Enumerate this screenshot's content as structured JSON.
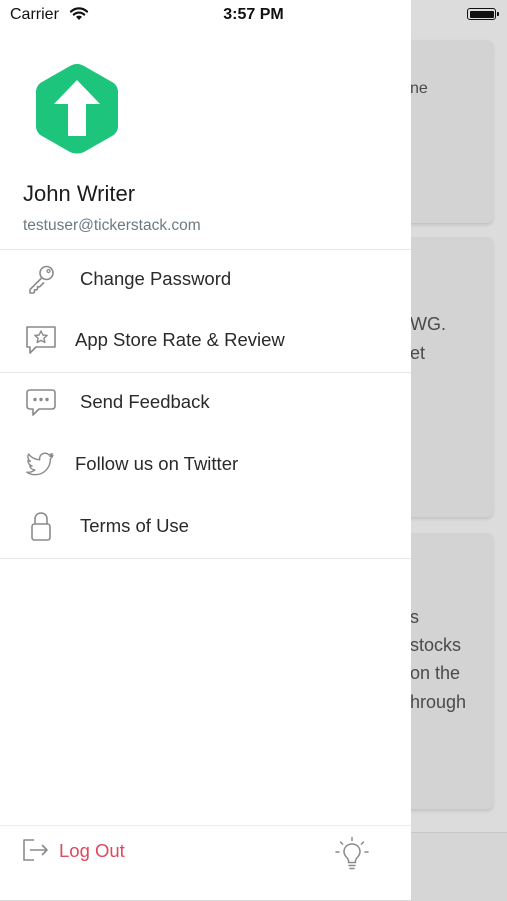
{
  "status_bar": {
    "carrier": "Carrier",
    "time": "3:57 PM"
  },
  "drawer": {
    "user": {
      "name": "John Writer",
      "email": "testuser@tickerstack.com"
    },
    "menu": [
      {
        "label": "Change Password",
        "icon": "key-icon"
      },
      {
        "label": "App Store Rate & Review",
        "icon": "star-speech-bubble-icon"
      },
      {
        "label": "Send Feedback",
        "icon": "chat-bubble-icon"
      },
      {
        "label": "Follow us on Twitter",
        "icon": "twitter-icon"
      },
      {
        "label": "Terms of Use",
        "icon": "lock-icon"
      }
    ],
    "footer": {
      "logout_label": "Log Out",
      "theme_icon": "lightbulb-icon"
    }
  },
  "background": {
    "fragments": [
      "ne",
      "WG.",
      "et",
      "s",
      "stocks",
      "on the",
      "hrough"
    ]
  },
  "colors": {
    "brand_green": "#1cc47c",
    "logout_red": "#e0485c",
    "icon_gray": "#8a8a8a"
  }
}
